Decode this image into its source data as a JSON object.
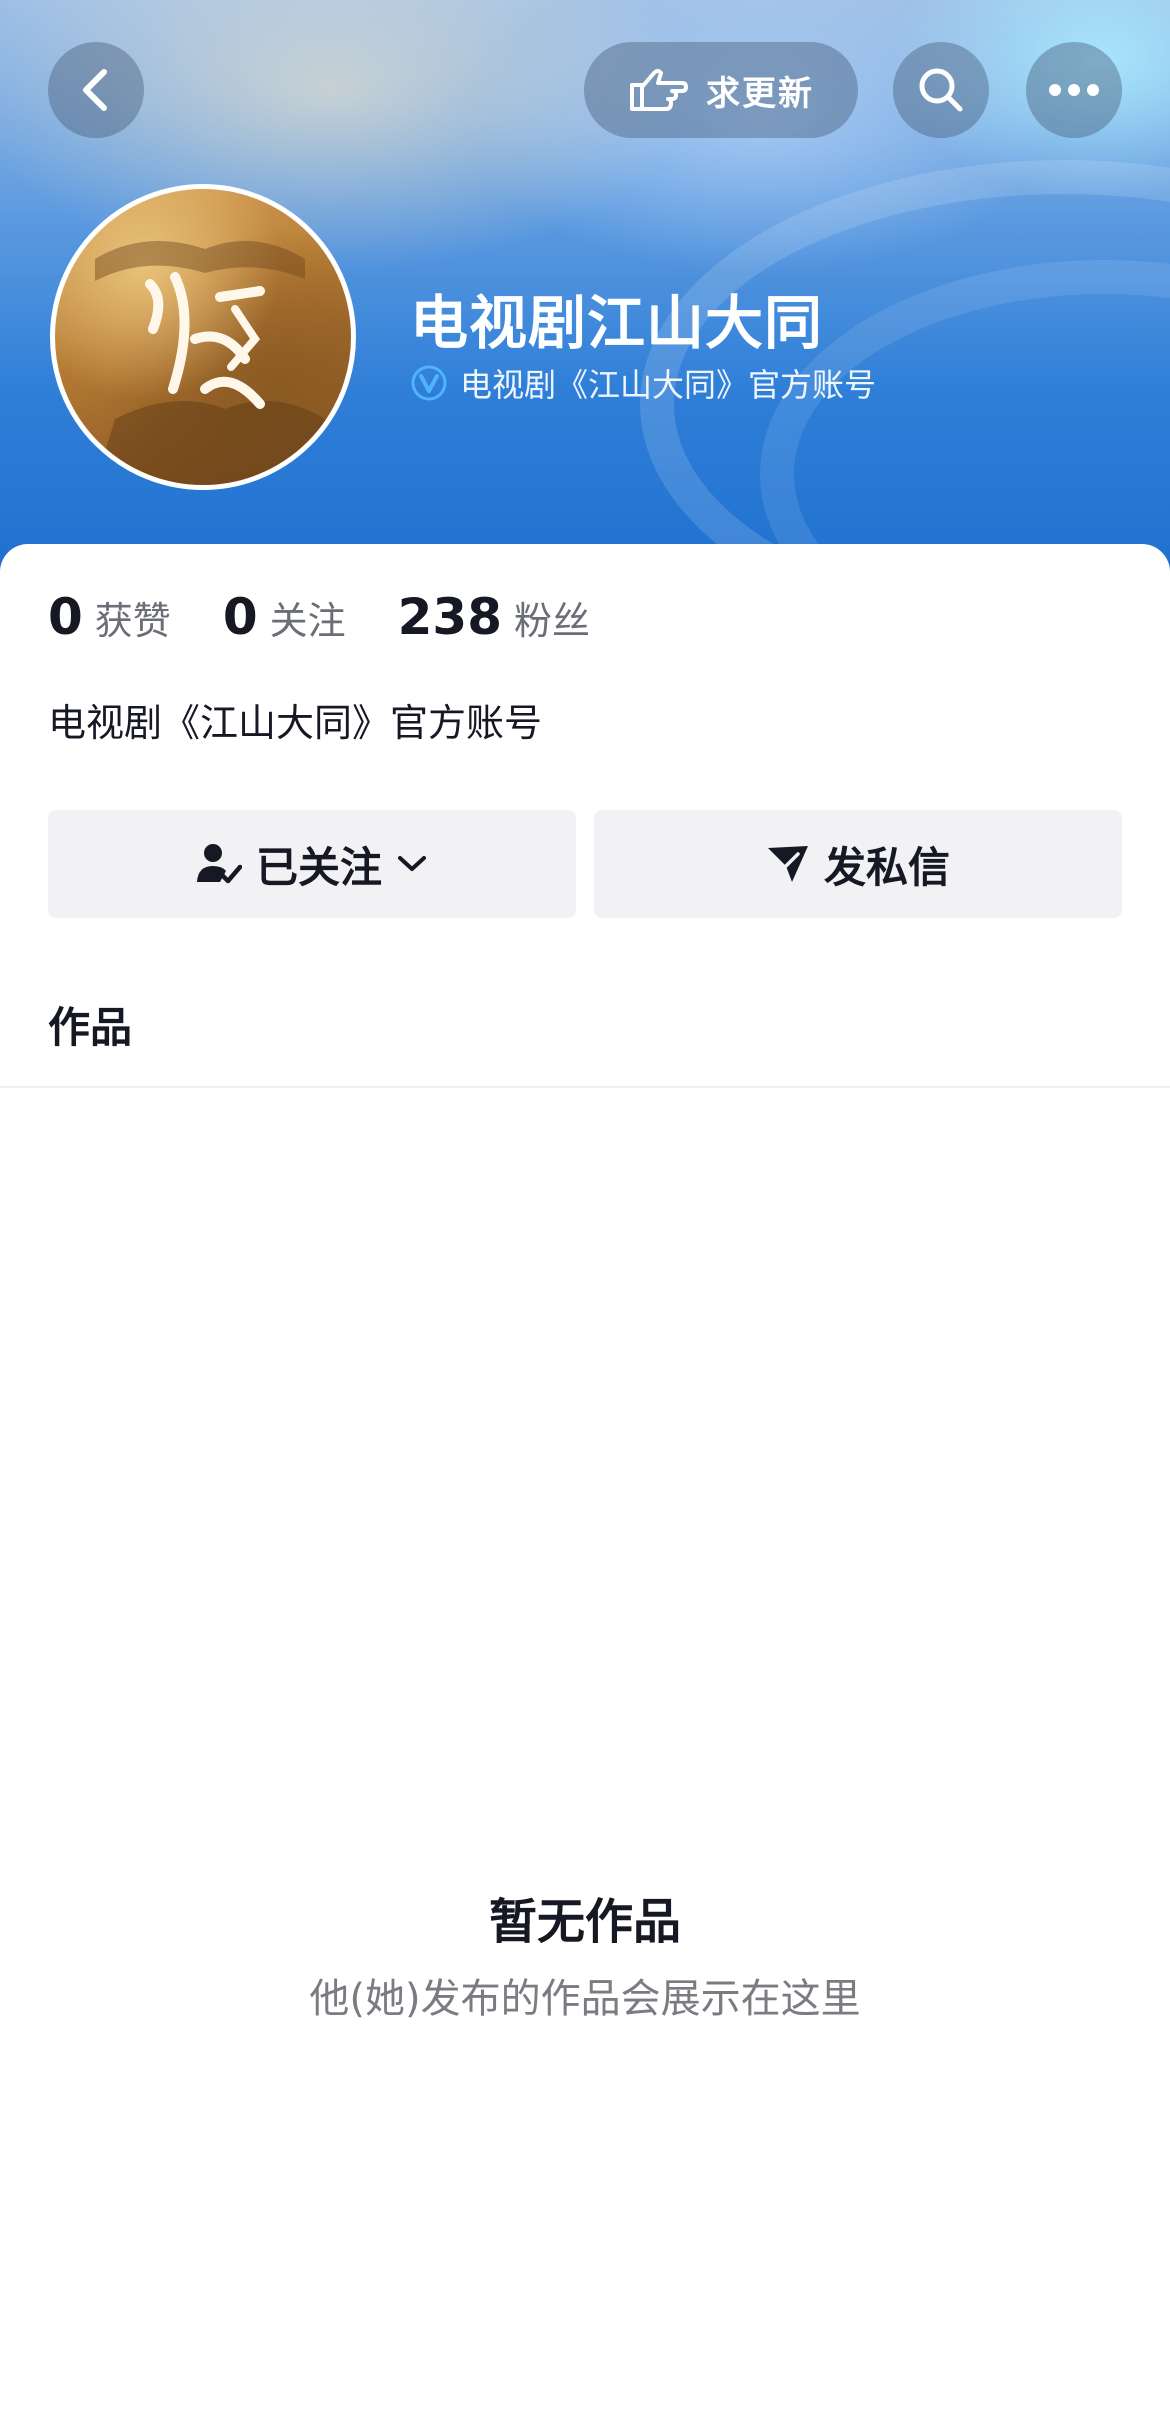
{
  "header": {
    "request_update_label": "求更新",
    "profile_name": "电视剧江山大同",
    "verification_text": "电视剧《江山大同》官方账号"
  },
  "stats": [
    {
      "value": "0",
      "label": "获赞"
    },
    {
      "value": "0",
      "label": "关注"
    },
    {
      "value": "238",
      "label": "粉丝"
    }
  ],
  "bio": "电视剧《江山大同》官方账号",
  "actions": {
    "follow_label": "已关注",
    "message_label": "发私信"
  },
  "tabs": {
    "works_label": "作品"
  },
  "empty_state": {
    "title": "暂无作品",
    "subtitle": "他(她)发布的作品会展示在这里"
  },
  "colors": {
    "banner_blue": "#2f7fd8",
    "verify_badge": "#4fb3ff",
    "button_bg": "#f2f2f4"
  },
  "icons": {
    "back": "chevron-left-icon",
    "request_update": "pointing-hand-icon",
    "search": "search-icon",
    "more": "more-dots-icon",
    "verified": "verified-v-icon",
    "follow": "user-check-icon",
    "dropdown": "chevron-down-icon",
    "message": "send-icon"
  }
}
